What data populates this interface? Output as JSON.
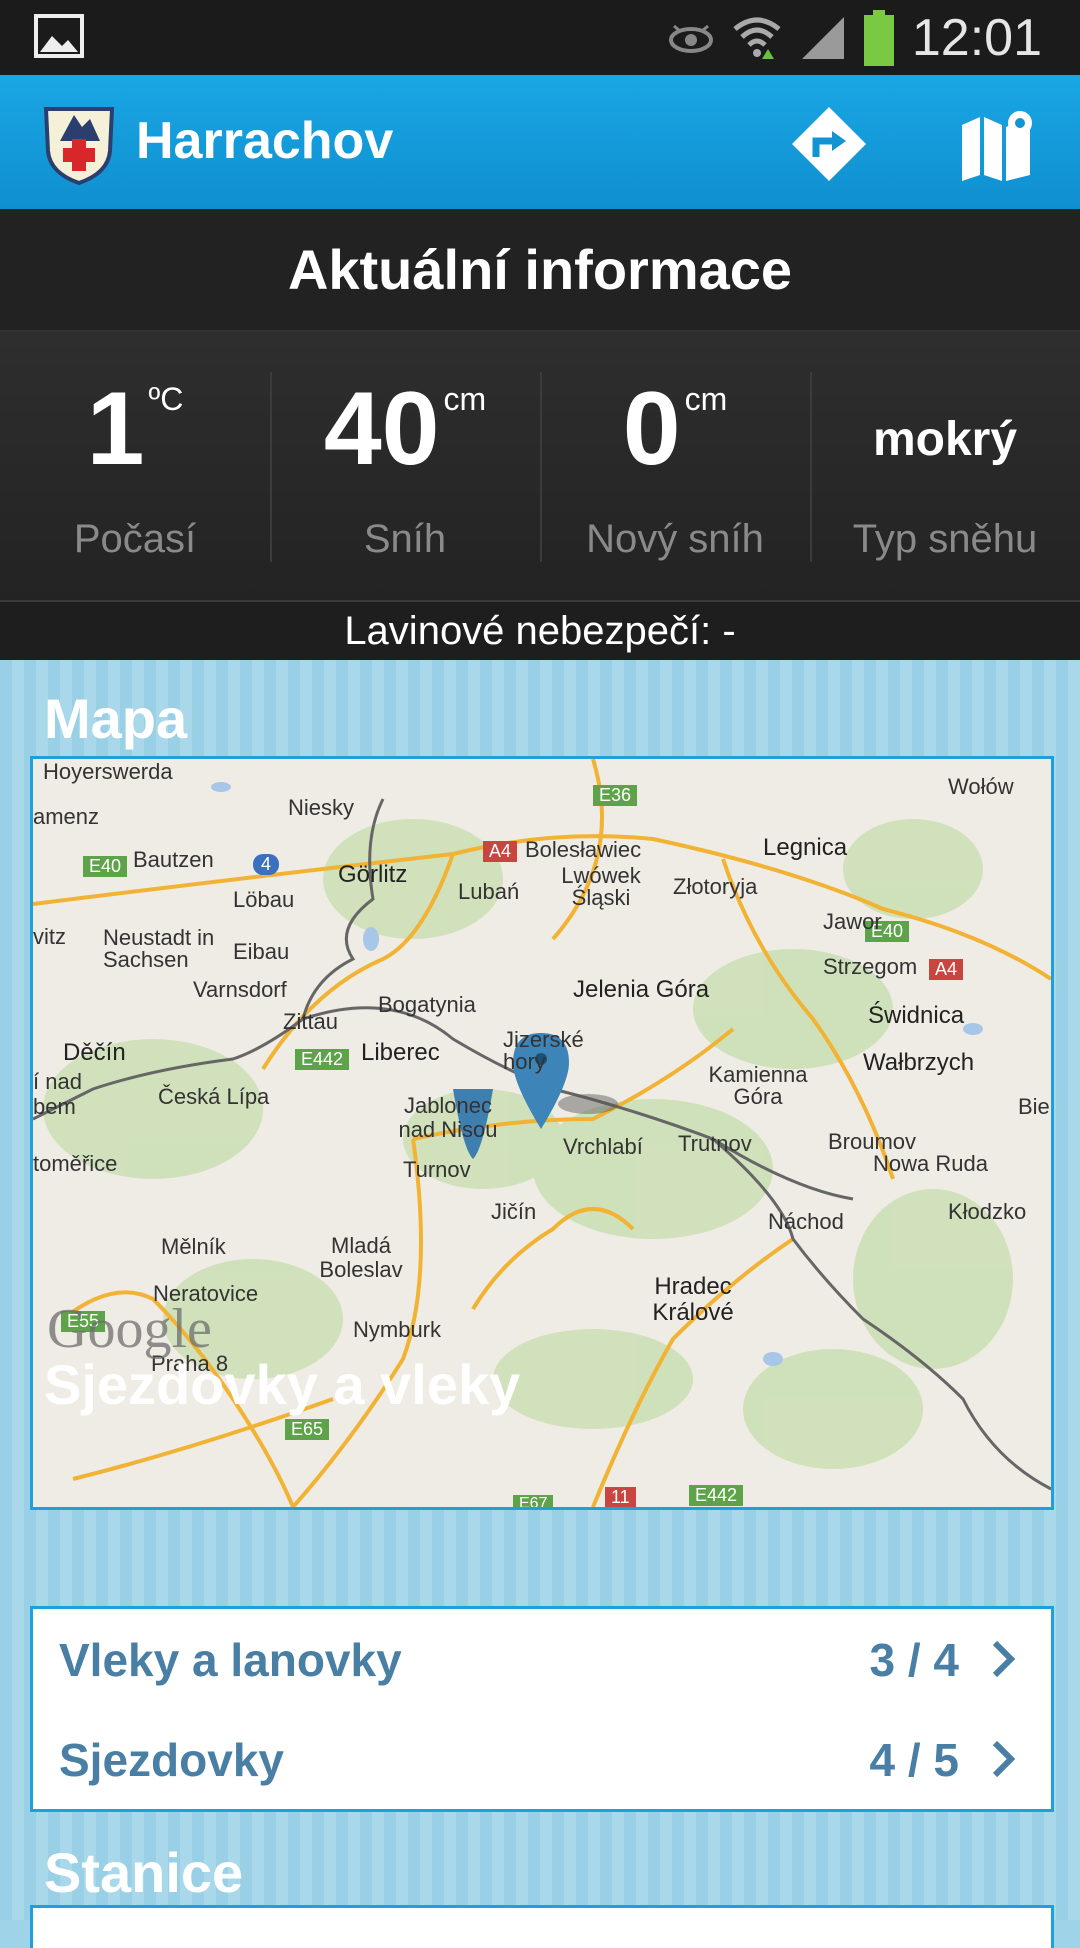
{
  "status_bar": {
    "time": "12:01"
  },
  "action_bar": {
    "title": "Harrachov",
    "icons": [
      "directions-icon",
      "map-icon"
    ]
  },
  "info": {
    "heading": "Aktuální informace",
    "stats": [
      {
        "value": "1",
        "unit": "ºC",
        "label": "Počasí"
      },
      {
        "value": "40",
        "unit": "cm",
        "label": "Sníh"
      },
      {
        "value": "0",
        "unit": "cm",
        "label": "Nový sníh"
      },
      {
        "value": "mokrý",
        "unit": "",
        "label": "Typ sněhu"
      }
    ],
    "avalanche": "Lavinové nebezpečí: -"
  },
  "map_section": {
    "title": "Mapa",
    "labels": [
      "Hoyerswerda",
      "Niesky",
      "amenz",
      "Bautzen",
      "Görlitz",
      "Löbau",
      "Lubań",
      "Bolesławiec",
      "Lwówek Śląski",
      "Złotoryja",
      "Legnica",
      "Wołów",
      "Jawor",
      "Strzegom",
      "vitz",
      "Neustadt in Sachsen",
      "Eibau",
      "Varnsdorf",
      "Zittau",
      "Bogatynia",
      "Jelenia Góra",
      "Świdnica",
      "Děčín",
      "Liberec",
      "Jizerské hory",
      "Wałbrzych",
      "í nad",
      "bem",
      "Česká Lípa",
      "Jablonec nad Nisou",
      "Kamienna Góra",
      "Bielaw",
      "Broumov",
      "Nowa Ruda",
      "toměřice",
      "Turnov",
      "Vrchlabí",
      "Trutnov",
      "Kłodzko",
      "Jičín",
      "Náchod",
      "Mělník",
      "Mladá Boleslav",
      "Neratovice",
      "Hradec Králové",
      "Nymburk",
      "Praha 8",
      "Google",
      "E40",
      "E36",
      "A4",
      "E442",
      "E55",
      "E65",
      "E67",
      "E442",
      "11",
      "4",
      "A4",
      "E40"
    ]
  },
  "slopes_section": {
    "title": "Sjezdovky a vleky",
    "items": [
      {
        "label": "Vleky a lanovky",
        "count": "3 / 4"
      },
      {
        "label": "Sjezdovky",
        "count": "4 / 5"
      }
    ]
  },
  "stations_section": {
    "title": "Stanice"
  },
  "colors": {
    "accent": "#1aa6e4",
    "list_text": "#4a7fa5",
    "background": "#9fd3e8"
  }
}
